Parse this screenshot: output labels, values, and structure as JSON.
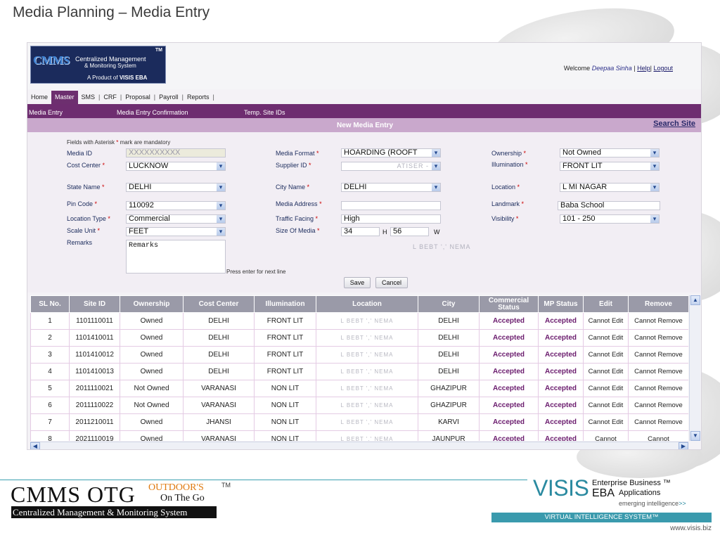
{
  "slide_title": "Media Planning – Media Entry",
  "logo": {
    "tm": "TM",
    "mark": "CMMS",
    "line1": "Centralized Management",
    "line2": "& Monitoring System",
    "product_prefix": "A Product of",
    "product_name": "VISIS EBA"
  },
  "header": {
    "welcome": "Welcome",
    "user": "Deepaa Sinha",
    "help": "Help",
    "logout": "Logout"
  },
  "menu": [
    "Home",
    "Master",
    "SMS",
    "CRF",
    "Proposal",
    "Payroll",
    "Reports"
  ],
  "menu_active": "Master",
  "submenu": [
    "Media Entry",
    "Media Entry Confirmation",
    "Temp. Site IDs"
  ],
  "panel": {
    "title": "New Media Entry",
    "search_site": "Search Site",
    "mandatory_note_pre": "Fields with Asterisk",
    "mandatory_note_post": "mark are mandatory"
  },
  "form": {
    "media_id": {
      "label": "Media ID",
      "value": "XXXXXXXXXX"
    },
    "cost_center": {
      "label": "Cost Center",
      "value": "LUCKNOW"
    },
    "state_name": {
      "label": "State Name",
      "value": "DELHI"
    },
    "pin_code": {
      "label": "Pin Code",
      "value": "110092"
    },
    "location_type": {
      "label": "Location Type",
      "value": "Commercial"
    },
    "scale_unit": {
      "label": "Scale Unit",
      "value": "FEET"
    },
    "remarks": {
      "label": "Remarks",
      "value": "Remarks"
    },
    "media_format": {
      "label": "Media Format",
      "value": "HOARDING (ROOFT"
    },
    "supplier_id": {
      "label": "Supplier ID",
      "value": "ATISER -"
    },
    "city_name": {
      "label": "City Name",
      "value": "DELHI"
    },
    "media_address": {
      "label": "Media Address",
      "value": ""
    },
    "traffic_facing": {
      "label": "Traffic Facing",
      "value": "High"
    },
    "size_of_media": {
      "label": "Size Of Media",
      "h_value": "34",
      "h_label": "H",
      "w_value": "56",
      "w_label": "W"
    },
    "ownership": {
      "label": "Ownership",
      "value": "Not Owned"
    },
    "illumination": {
      "label": "Illumination",
      "value": "FRONT LIT"
    },
    "location": {
      "label": "Location",
      "value": "L    MI NAGAR"
    },
    "landmark": {
      "label": "Landmark",
      "value": "Baba School"
    },
    "visibility": {
      "label": "Visibility",
      "value": "101 - 250"
    },
    "blurred_address": "L BEBT ',' NEMA",
    "hint": "Press enter for next line",
    "save": "Save",
    "cancel": "Cancel"
  },
  "grid": {
    "columns": [
      "SL No.",
      "Site ID",
      "Ownership",
      "Cost Center",
      "Illumination",
      "Location",
      "City",
      "Commercial Status",
      "MP Status",
      "Edit",
      "Remove"
    ],
    "rows": [
      {
        "sl": "1",
        "site_id": "1101110011",
        "ownership": "Owned",
        "cost_center": "DELHI",
        "illumination": "FRONT LIT",
        "location": "L BEBT ',' NEMA",
        "city": "DELHI",
        "commercial_status": "Accepted",
        "mp_status": "Accepted",
        "edit": "Cannot Edit",
        "remove": "Cannot Remove"
      },
      {
        "sl": "2",
        "site_id": "1101410011",
        "ownership": "Owned",
        "cost_center": "DELHI",
        "illumination": "FRONT LIT",
        "location": "L BEBT ',' NEMA",
        "city": "DELHI",
        "commercial_status": "Accepted",
        "mp_status": "Accepted",
        "edit": "Cannot Edit",
        "remove": "Cannot Remove"
      },
      {
        "sl": "3",
        "site_id": "1101410012",
        "ownership": "Owned",
        "cost_center": "DELHI",
        "illumination": "FRONT LIT",
        "location": "L BEBT ',' NEMA",
        "city": "DELHI",
        "commercial_status": "Accepted",
        "mp_status": "Accepted",
        "edit": "Cannot Edit",
        "remove": "Cannot Remove"
      },
      {
        "sl": "4",
        "site_id": "1101410013",
        "ownership": "Owned",
        "cost_center": "DELHI",
        "illumination": "FRONT LIT",
        "location": "L BEBT ',' NEMA",
        "city": "DELHI",
        "commercial_status": "Accepted",
        "mp_status": "Accepted",
        "edit": "Cannot Edit",
        "remove": "Cannot Remove"
      },
      {
        "sl": "5",
        "site_id": "2011110021",
        "ownership": "Not Owned",
        "cost_center": "VARANASI",
        "illumination": "NON LIT",
        "location": "L BEBT ',' NEMA",
        "city": "GHAZIPUR",
        "commercial_status": "Accepted",
        "mp_status": "Accepted",
        "edit": "Cannot Edit",
        "remove": "Cannot Remove"
      },
      {
        "sl": "6",
        "site_id": "2011110022",
        "ownership": "Not Owned",
        "cost_center": "VARANASI",
        "illumination": "NON LIT",
        "location": "L BEBT ',' NEMA",
        "city": "GHAZIPUR",
        "commercial_status": "Accepted",
        "mp_status": "Accepted",
        "edit": "Cannot Edit",
        "remove": "Cannot Remove"
      },
      {
        "sl": "7",
        "site_id": "2011210011",
        "ownership": "Owned",
        "cost_center": "JHANSI",
        "illumination": "NON LIT",
        "location": "L BEBT ',' NEMA",
        "city": "KARVI",
        "commercial_status": "Accepted",
        "mp_status": "Accepted",
        "edit": "Cannot Edit",
        "remove": "Cannot Remove"
      },
      {
        "sl": "8",
        "site_id": "2021110019",
        "ownership": "Owned",
        "cost_center": "VARANASI",
        "illumination": "NON LIT",
        "location": "L BEBT ',' NEMA",
        "city": "JAUNPUR",
        "commercial_status": "Accepted",
        "mp_status": "Accepted",
        "edit": "Cannot",
        "remove": "Cannot"
      }
    ]
  },
  "footer": {
    "cmms_otg": "CMMS OTG",
    "outdoors": "OUTDOOR'S",
    "tm": "TM",
    "on_the_go": "On The Go",
    "cmms_full": "Centralized Management & Monitoring System",
    "visis": "VISIS",
    "eba": "EBA",
    "enterprise": "Enterprise Business ™",
    "applications": "Applications",
    "emerging": "emerging intelligence",
    "emerging_arrows": ">>",
    "vis_bar": "VIRTUAL INTELLIGENCE SYSTEM™",
    "site": "www.visis.biz"
  },
  "colors": {
    "menu_purple": "#6e2d70",
    "panel_lavender": "#c9a8cc",
    "accepted": "#6a1b6d",
    "visis_teal": "#2a8aa0"
  }
}
